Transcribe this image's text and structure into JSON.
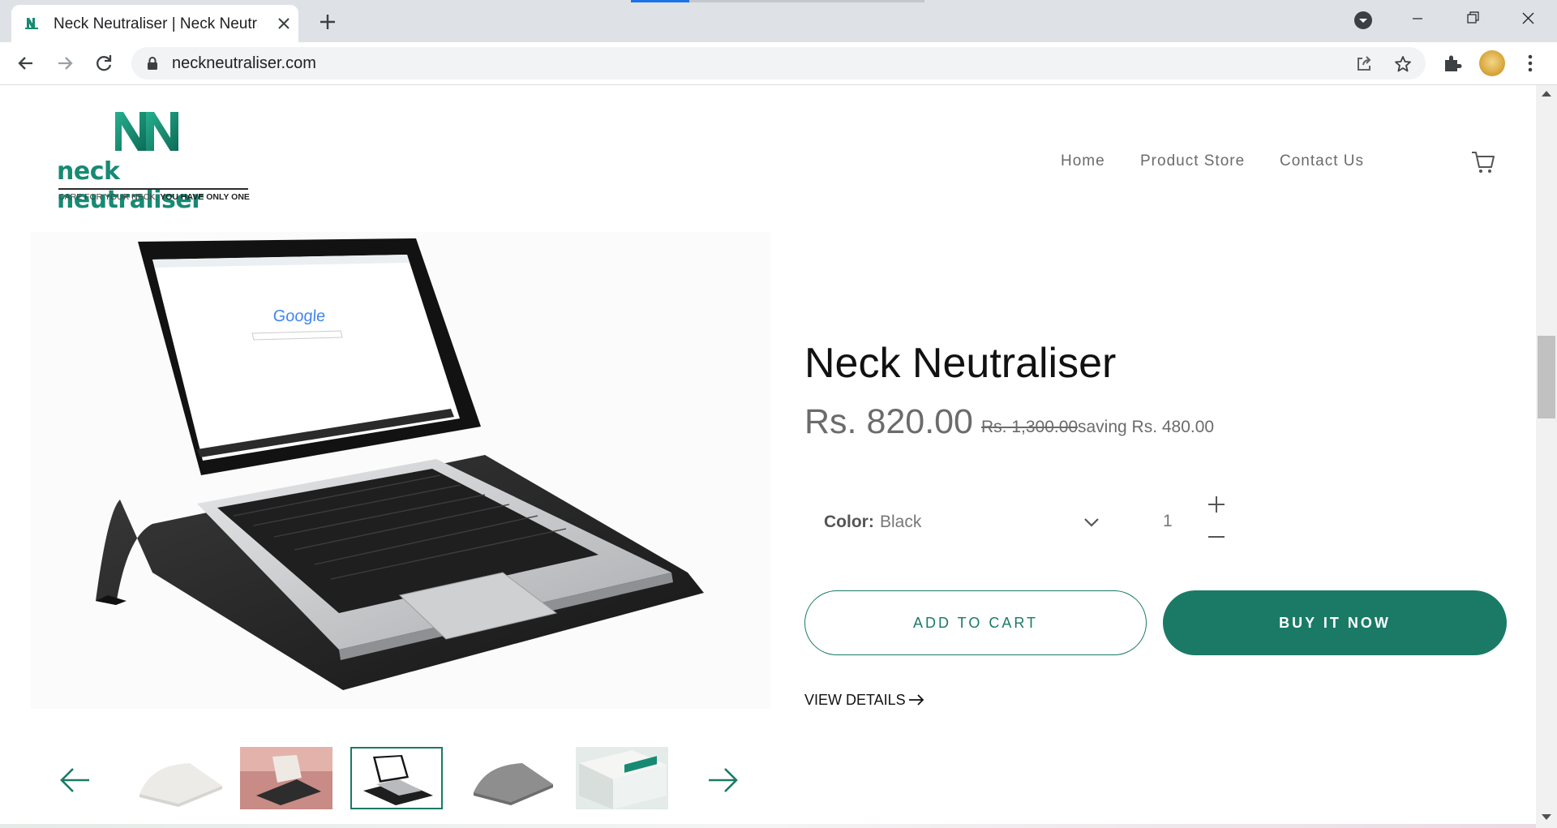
{
  "browser": {
    "tab_title": "Neck Neutraliser | Neck Neutraliser",
    "url": "neckneutraliser.com"
  },
  "site": {
    "logo_text": "neck neutraliser",
    "tagline_normal": "CARE FOR YOUR NECK, ",
    "tagline_bold": "YOU HAVE ONLY ONE",
    "nav": [
      "Home",
      "Product Store",
      "Contact Us"
    ]
  },
  "product": {
    "title": "Neck Neutraliser",
    "price": "Rs. 820.00",
    "compare_price": "Rs. 1,300.00",
    "saving": "saving Rs. 480.00",
    "option_label": "Color:",
    "option_value": "Black",
    "quantity": "1",
    "add_to_cart": "ADD TO CART",
    "buy_now": "BUY IT NOW",
    "view_details": "VIEW DETAILS",
    "thumbnail_count": 5,
    "selected_thumbnail": 3
  },
  "colors": {
    "brand": "#1a7a66",
    "logo_green": "#178a73"
  },
  "icons": {
    "cart": "shopping-cart-icon",
    "prev": "arrow-left-icon",
    "next": "arrow-right-icon"
  }
}
